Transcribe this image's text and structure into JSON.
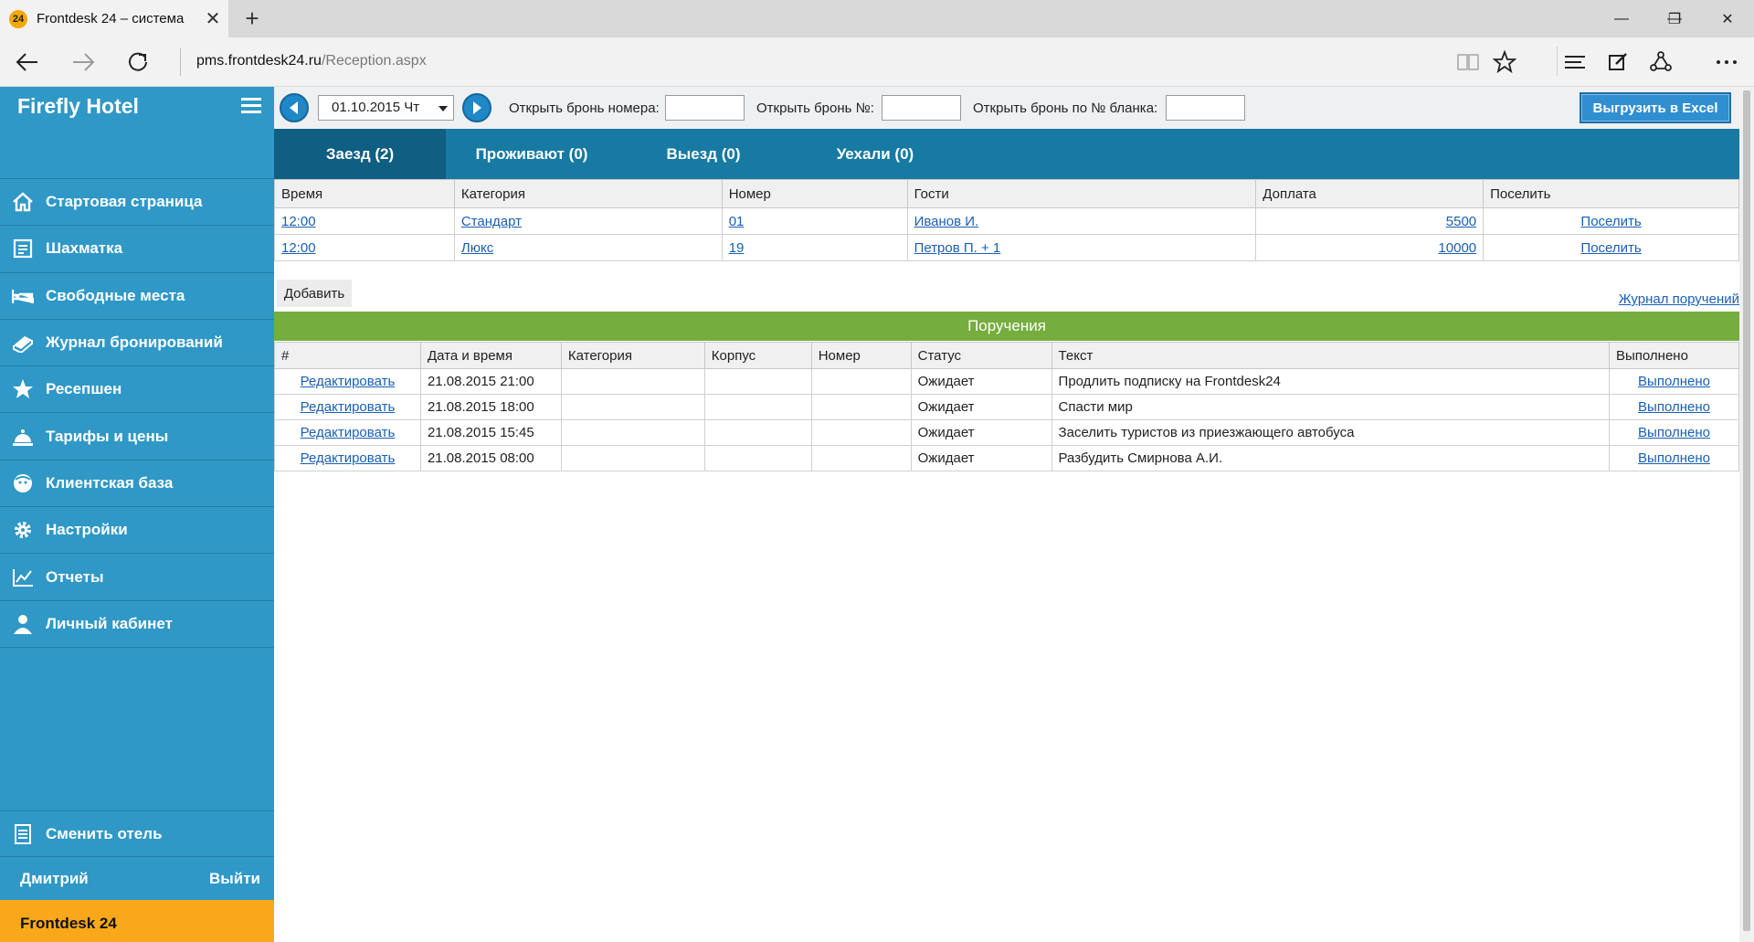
{
  "browser": {
    "tab_icon_text": "24",
    "tab_title": "Frontdesk 24 – система",
    "tab_close": "✕",
    "new_tab": "+",
    "url_host": "pms.frontdesk24.ru",
    "url_path": "/Reception.aspx",
    "min": "—",
    "restore": "❐",
    "close": "✕"
  },
  "sidebar": {
    "brand": "Firefly Hotel",
    "items": [
      {
        "label": "Стартовая страница",
        "icon": "home-icon"
      },
      {
        "label": "Шахматка",
        "icon": "grid-icon"
      },
      {
        "label": "Свободные места",
        "icon": "bed-icon"
      },
      {
        "label": "Журнал бронирований",
        "icon": "book-icon"
      },
      {
        "label": "Ресепшен",
        "icon": "star-icon"
      },
      {
        "label": "Тарифы и цены",
        "icon": "service-bell-icon"
      },
      {
        "label": "Клиентская база",
        "icon": "client-face-icon"
      },
      {
        "label": "Настройки",
        "icon": "gear-icon"
      },
      {
        "label": "Отчеты",
        "icon": "chart-icon"
      },
      {
        "label": "Личный кабинет",
        "icon": "user-icon"
      }
    ],
    "switch_hotel": "Сменить отель",
    "user_name": "Дмитрий",
    "logout": "Выйти",
    "footer_brand": "Frontdesk 24"
  },
  "toolbar": {
    "date": "01.10.2015 Чт",
    "open_room_label": "Открыть бронь номера:",
    "open_booking_label": "Открыть бронь №:",
    "open_blank_label": "Открыть бронь по № бланка:",
    "excel_button": "Выгрузить в Excel"
  },
  "tabs": [
    "Заезд (2)",
    "Проживают (0)",
    "Выезд (0)",
    "Уехали (0)"
  ],
  "arrivals": {
    "headers": [
      "Время",
      "Категория",
      "Номер",
      "Гости",
      "Доплата",
      "Поселить"
    ],
    "rows": [
      {
        "time": "12:00",
        "category": "Стандарт",
        "room": "01",
        "guests": "Иванов И.",
        "payment": "5500",
        "action": "Поселить"
      },
      {
        "time": "12:00",
        "category": "Люкс",
        "room": "19",
        "guests": "Петров П. + 1",
        "payment": "10000",
        "action": "Поселить"
      }
    ]
  },
  "add_button": "Добавить",
  "journal_link": "Журнал поручений",
  "tasks_title": "Поручения",
  "tasks": {
    "headers": [
      "#",
      "Дата и время",
      "Категория",
      "Корпус",
      "Номер",
      "Статус",
      "Текст",
      "Выполнено"
    ],
    "rows": [
      {
        "edit": "Редактировать",
        "datetime": "21.08.2015 21:00",
        "category": "",
        "building": "",
        "room": "",
        "status": "Ожидает",
        "text": "Продлить подписку на Frontdesk24",
        "done": "Выполнено"
      },
      {
        "edit": "Редактировать",
        "datetime": "21.08.2015 18:00",
        "category": "",
        "building": "",
        "room": "",
        "status": "Ожидает",
        "text": "Спасти мир",
        "done": "Выполнено"
      },
      {
        "edit": "Редактировать",
        "datetime": "21.08.2015 15:45",
        "category": "",
        "building": "",
        "room": "",
        "status": "Ожидает",
        "text": "Заселить туристов из приезжающего автобуса",
        "done": "Выполнено"
      },
      {
        "edit": "Редактировать",
        "datetime": "21.08.2015 08:00",
        "category": "",
        "building": "",
        "room": "",
        "status": "Ожидает",
        "text": "Разбудить Смирнова А.И.",
        "done": "Выполнено"
      }
    ]
  }
}
